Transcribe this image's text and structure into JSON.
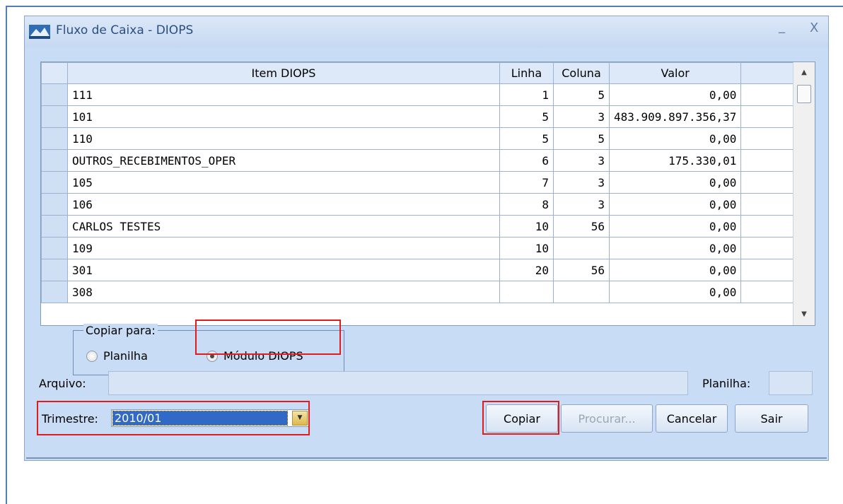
{
  "window": {
    "title": "Fluxo de Caixa - DIOPS",
    "minimize": "_",
    "close": "X"
  },
  "grid": {
    "columns": [
      "Item DIOPS",
      "Linha",
      "Coluna",
      "Valor"
    ],
    "rows": [
      {
        "item": "111",
        "linha": "1",
        "coluna": "5",
        "valor": "0,00"
      },
      {
        "item": "101",
        "linha": "5",
        "coluna": "3",
        "valor": "483.909.897.356,37"
      },
      {
        "item": "110",
        "linha": "5",
        "coluna": "5",
        "valor": "0,00"
      },
      {
        "item": "OUTROS_RECEBIMENTOS_OPER",
        "linha": "6",
        "coluna": "3",
        "valor": "175.330,01"
      },
      {
        "item": "105",
        "linha": "7",
        "coluna": "3",
        "valor": "0,00"
      },
      {
        "item": "106",
        "linha": "8",
        "coluna": "3",
        "valor": "0,00"
      },
      {
        "item": "CARLOS TESTES",
        "linha": "10",
        "coluna": "56",
        "valor": "0,00"
      },
      {
        "item": "109",
        "linha": "10",
        "coluna": "",
        "valor": "0,00"
      },
      {
        "item": "301",
        "linha": "20",
        "coluna": "56",
        "valor": "0,00"
      },
      {
        "item": "308",
        "linha": "",
        "coluna": "",
        "valor": "0,00"
      }
    ]
  },
  "copy_to": {
    "legend": "Copiar para:",
    "options": [
      "Planilha",
      "Módulo DIOPS"
    ],
    "selected": "Módulo DIOPS"
  },
  "form": {
    "arquivo_label": "Arquivo:",
    "planilha_label": "Planilha:",
    "trimestre_label": "Trimestre:",
    "trimestre_value": "2010/01"
  },
  "buttons": {
    "copiar": "Copiar",
    "procurar": "Procurar...",
    "cancelar": "Cancelar",
    "sair": "Sair"
  },
  "colors": {
    "window_bg": "#c9dcf5",
    "highlight": "#e01c1c",
    "selection": "#3169c6"
  }
}
